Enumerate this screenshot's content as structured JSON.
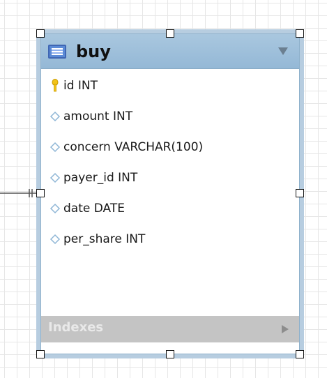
{
  "table": {
    "name": "buy",
    "columns": [
      {
        "label": "id INT",
        "key": "primary"
      },
      {
        "label": "amount INT",
        "key": "none"
      },
      {
        "label": "concern VARCHAR(100)",
        "key": "none"
      },
      {
        "label": "payer_id INT",
        "key": "none"
      },
      {
        "label": "date DATE",
        "key": "none"
      },
      {
        "label": "per_share INT",
        "key": "none"
      }
    ],
    "indexes_label": "Indexes"
  },
  "colors": {
    "header": "#9fc0db",
    "border": "#b7cde0",
    "indexes_bar": "#c4c4c4",
    "primary_key": "#f2c318",
    "column_icon": "#8fb6d6"
  },
  "icons": {
    "table": "table-icon",
    "primary_key": "key-icon",
    "column": "diamond-icon",
    "collapse": "triangle-down-icon",
    "expand": "triangle-right-icon",
    "relationship": "one-to-one-connector"
  }
}
